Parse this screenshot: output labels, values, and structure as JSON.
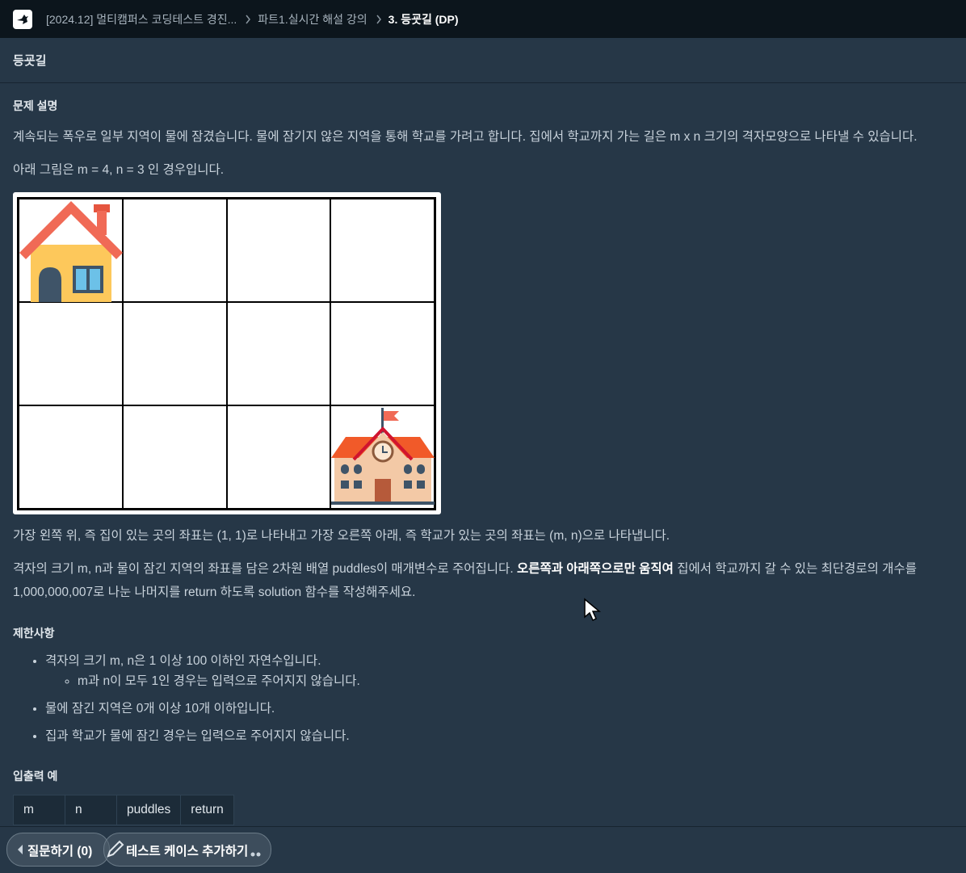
{
  "header": {
    "logo_icon": "bird-icon",
    "crumbs": [
      "[2024.12] 멀티캠퍼스 코딩테스트 경진...",
      "파트1.실시간 해설 강의",
      "3. 등굣길 (DP)"
    ]
  },
  "title": "등굣길",
  "section_problem": "문제 설명",
  "p1": "계속되는 폭우로 일부 지역이 물에 잠겼습니다. 물에 잠기지 않은 지역을 통해 학교를 가려고 합니다. 집에서 학교까지 가는 길은 m x n 크기의 격자모양으로 나타낼 수 있습니다.",
  "p2": "아래 그림은 m = 4, n = 3 인 경우입니다.",
  "grid": {
    "columns": 4,
    "rows": 3,
    "start_icon": "house-icon",
    "end_icon": "school-icon"
  },
  "p3": "가장 왼쪽 위, 즉 집이 있는 곳의 좌표는 (1, 1)로 나타내고 가장 오른쪽 아래, 즉 학교가 있는 곳의 좌표는 (m, n)으로 나타냅니다.",
  "p4a": "격자의 크기 m, n과 물이 잠긴 지역의 좌표를 담은 2차원 배열 puddles이 매개변수로 주어집니다. ",
  "p4b": "오른쪽과 아래쪽으로만 움직여",
  "p4c": " 집에서 학교까지 갈 수 있는 최단경로의 개수를 1,000,000,007로 나눈 나머지를 return 하도록 solution 함수를 작성해주세요.",
  "section_limits": "제한사항",
  "limits": {
    "item1": "격자의 크기 m, n은 1 이상 100 이하인 자연수입니다.",
    "item1_sub": "m과 n이 모두 1인 경우는 입력으로 주어지지 않습니다.",
    "item2": "물에 잠긴 지역은 0개 이상 10개 이하입니다.",
    "item3": "집과 학교가 물에 잠긴 경우는 입력으로 주어지지 않습니다."
  },
  "section_io": "입출력 예",
  "io_headers": [
    "m",
    "n",
    "puddles",
    "return"
  ],
  "footer": {
    "question_label": "질문하기 (0)",
    "testcase_label": "테스트 케이스 추가하기"
  }
}
